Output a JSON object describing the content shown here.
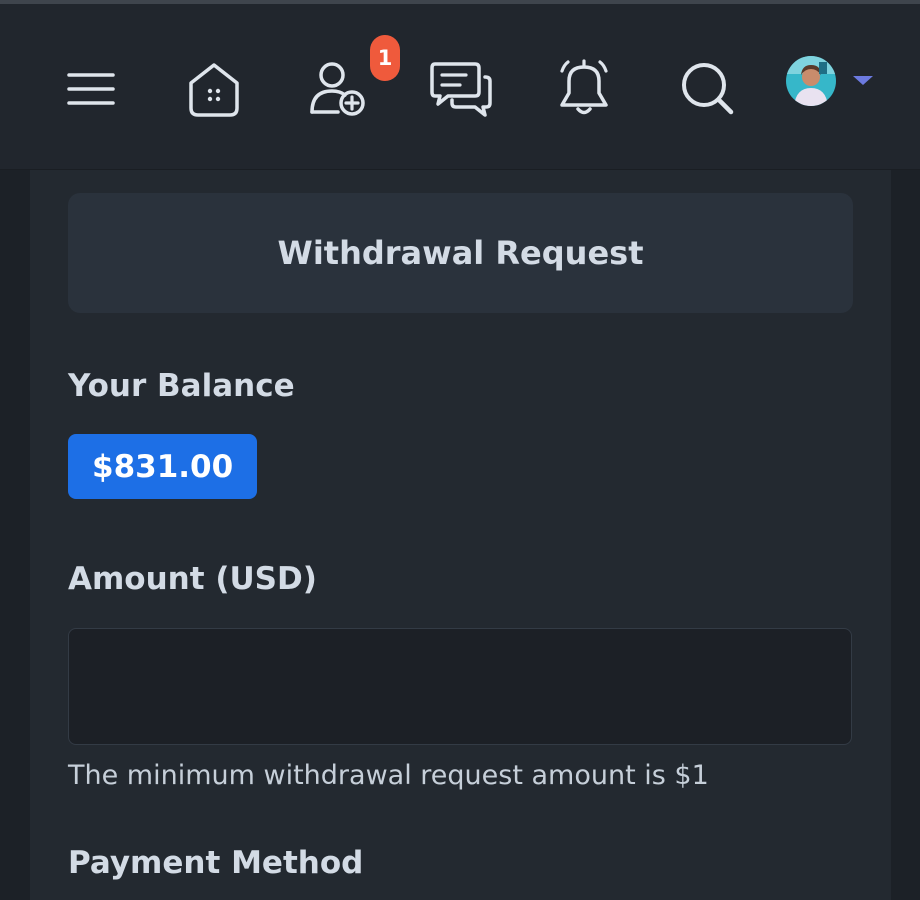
{
  "navbar": {
    "icons": [
      "menu-icon",
      "home-icon",
      "add-friend-icon",
      "messages-icon",
      "bell-icon",
      "search-icon"
    ],
    "friend_requests_badge": "1",
    "accent_caret_color": "#6c7ae0"
  },
  "page": {
    "title": "Withdrawal Request"
  },
  "balance": {
    "label": "Your Balance",
    "value": "$831.00",
    "pill_color": "#1d6fe6"
  },
  "amount": {
    "label": "Amount (USD)",
    "value": "",
    "placeholder": "",
    "help_text": "The minimum withdrawal request amount is $1"
  },
  "payment": {
    "label": "Payment Method"
  }
}
